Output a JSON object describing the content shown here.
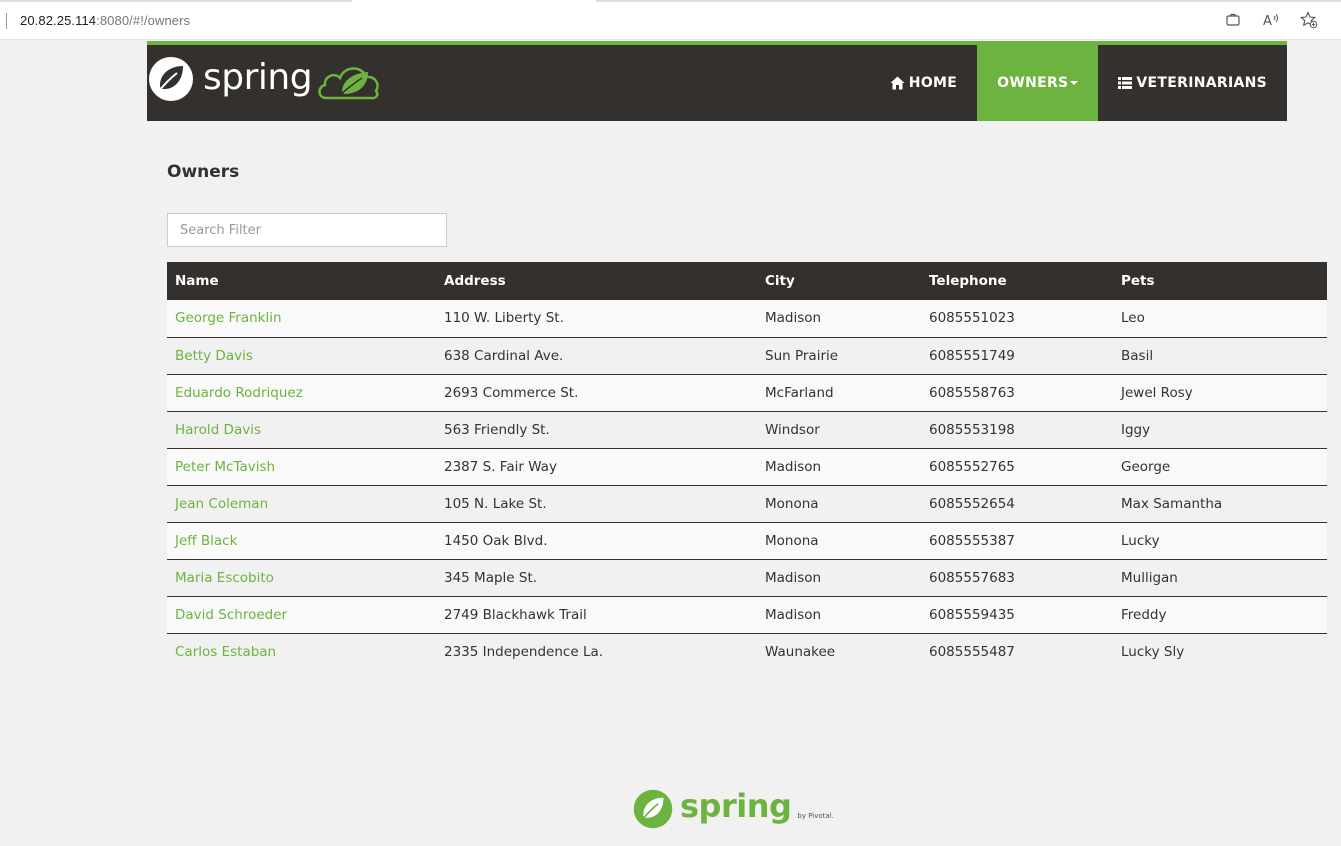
{
  "browser": {
    "url_host": "20.82.25.114",
    "url_rest": ":8080/#!/owners"
  },
  "nav": {
    "logo_text": "spring",
    "items": [
      {
        "label": "Home",
        "icon": "home-icon"
      },
      {
        "label": "Owners",
        "icon": "caret-down-icon"
      },
      {
        "label": "Veterinarians",
        "icon": "list-icon"
      }
    ]
  },
  "page": {
    "title": "Owners",
    "search_placeholder": "Search Filter"
  },
  "table": {
    "headers": [
      "Name",
      "Address",
      "City",
      "Telephone",
      "Pets"
    ],
    "rows": [
      [
        "George Franklin",
        "110 W. Liberty St.",
        "Madison",
        "6085551023",
        "Leo"
      ],
      [
        "Betty Davis",
        "638 Cardinal Ave.",
        "Sun Prairie",
        "6085551749",
        "Basil"
      ],
      [
        "Eduardo Rodriquez",
        "2693 Commerce St.",
        "McFarland",
        "6085558763",
        "Jewel Rosy"
      ],
      [
        "Harold Davis",
        "563 Friendly St.",
        "Windsor",
        "6085553198",
        "Iggy"
      ],
      [
        "Peter McTavish",
        "2387 S. Fair Way",
        "Madison",
        "6085552765",
        "George"
      ],
      [
        "Jean Coleman",
        "105 N. Lake St.",
        "Monona",
        "6085552654",
        "Max Samantha"
      ],
      [
        "Jeff Black",
        "1450 Oak Blvd.",
        "Monona",
        "6085555387",
        "Lucky"
      ],
      [
        "Maria Escobito",
        "345 Maple St.",
        "Madison",
        "6085557683",
        "Mulligan"
      ],
      [
        "David Schroeder",
        "2749 Blackhawk Trail",
        "Madison",
        "6085559435",
        "Freddy"
      ],
      [
        "Carlos Estaban",
        "2335 Independence La.",
        "Waunakee",
        "6085555487",
        "Lucky Sly"
      ]
    ]
  },
  "footer": {
    "logo_text": "spring",
    "by_text": "by Pivotal."
  },
  "colors": {
    "brand_green": "#6db33f",
    "nav_dark": "#34302d"
  }
}
